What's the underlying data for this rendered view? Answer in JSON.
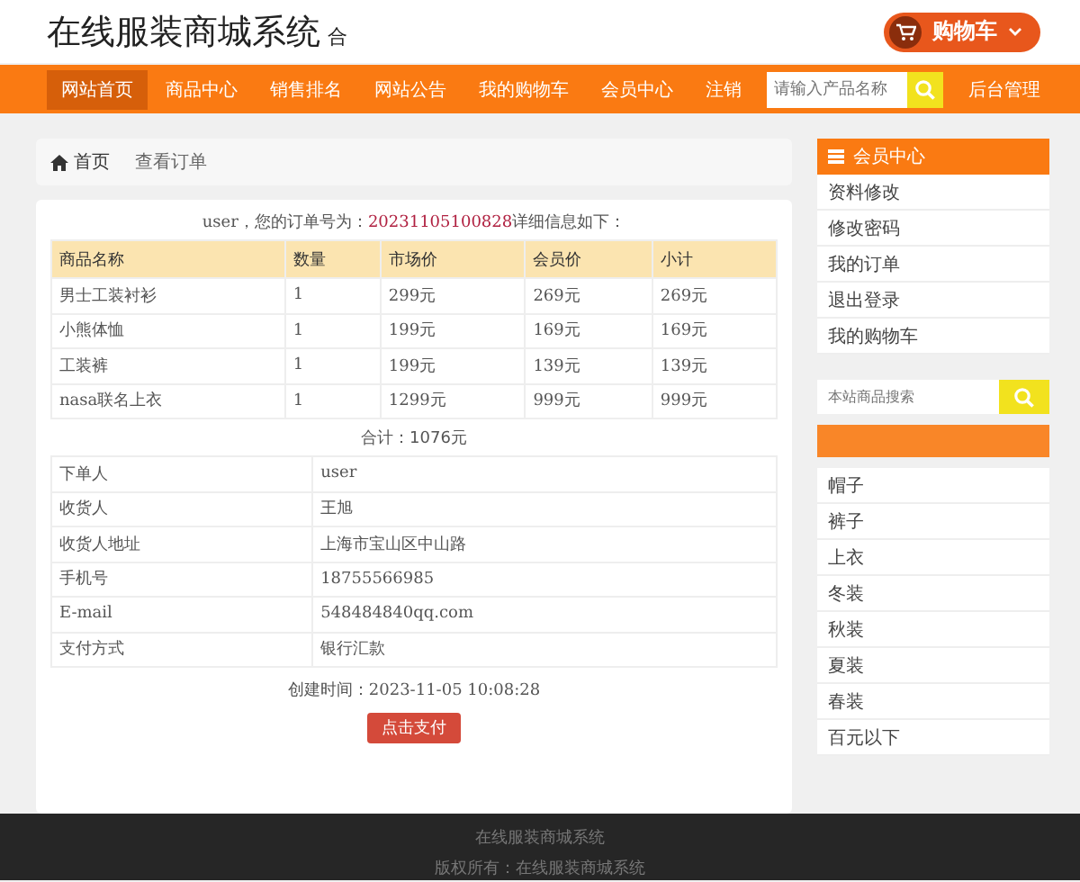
{
  "header": {
    "title": "在线服装商城系统",
    "title_suffix": "合",
    "cart_button": "购物车"
  },
  "nav": {
    "items": [
      {
        "label": "网站首页",
        "selected": true
      },
      {
        "label": "商品中心",
        "selected": false
      },
      {
        "label": "销售排名",
        "selected": false
      },
      {
        "label": "网站公告",
        "selected": false
      },
      {
        "label": "我的购物车",
        "selected": false
      },
      {
        "label": "会员中心",
        "selected": false
      },
      {
        "label": "注销",
        "selected": false
      }
    ],
    "search": {
      "placeholder": "请输入产品名称"
    },
    "admin_link": "后台管理"
  },
  "breadcrumb": [
    "首页",
    "查看订单"
  ],
  "order": {
    "intro": "user，您的订单号为：",
    "order_no": "20231105100828",
    "intro_end": "详细信息如下：",
    "columns": [
      "商品名称",
      "数量",
      "市场价",
      "会员价",
      "小计"
    ],
    "rows": [
      [
        "男士工装衬衫",
        "1",
        "299元",
        "269元",
        "269元"
      ],
      [
        "小熊体恤",
        "1",
        "199元",
        "169元",
        "169元"
      ],
      [
        "工装裤",
        "1",
        "199元",
        "139元",
        "139元"
      ],
      [
        "nasa联名上衣",
        "1",
        "1299元",
        "999元",
        "999元"
      ]
    ],
    "total": "合计：1076元",
    "details": [
      [
        "下单人",
        "user"
      ],
      [
        "收货人",
        "王旭"
      ],
      [
        "收货人地址",
        "上海市宝山区中山路"
      ],
      [
        "手机号",
        "18755566985"
      ],
      [
        "E-mail",
        "548484840qq.com"
      ],
      [
        "支付方式",
        "银行汇款"
      ]
    ],
    "created": "创建时间：2023-11-05 10:08:28",
    "pay_button": "点击支付"
  },
  "sidebar": {
    "member_title": "会员中心",
    "member_links": [
      "资料修改",
      "修改密码",
      "我的订单",
      "退出登录",
      "我的购物车"
    ],
    "search": {
      "placeholder": "本站商品搜索"
    },
    "categories": [
      "帽子",
      "裤子",
      "上衣",
      "冬装",
      "秋装",
      "夏装",
      "春装",
      "百元以下"
    ]
  },
  "footer": [
    "在线服装商城系统",
    "版权所有：在线服装商城系统"
  ]
}
